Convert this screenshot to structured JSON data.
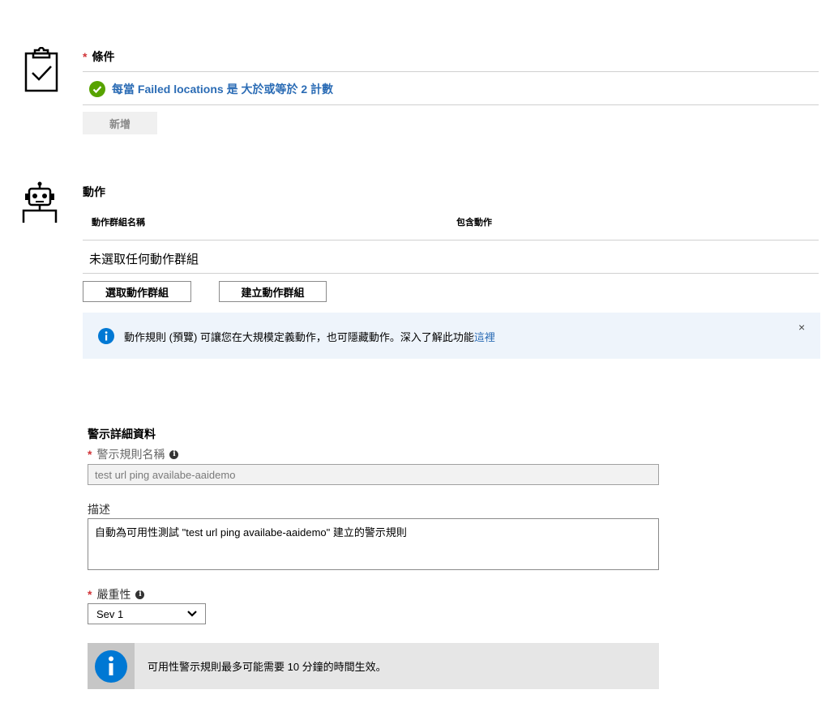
{
  "condition": {
    "required_mark": "*",
    "title": "條件",
    "link_text": "每當 Failed locations 是 大於或等於 2 計數",
    "add_button": "新增"
  },
  "actions": {
    "title": "動作",
    "col_group_name": "動作群組名稱",
    "col_contains": "包含動作",
    "empty_text": "未選取任何動作群組",
    "select_button": "選取動作群組",
    "create_button": "建立動作群組",
    "info_text": "動作規則 (預覽) 可讓您在大規模定義動作，也可隱藏動作。深入了解此功能",
    "info_link": "這裡",
    "close_glyph": "×"
  },
  "alert_details": {
    "title": "警示詳細資料",
    "rule_name_label": "警示規則名稱",
    "rule_name_value": "test url ping availabe-aaidemo",
    "description_label": "描述",
    "description_value": "自動為可用性測試 \"test url ping availabe-aaidemo\" 建立的警示規則",
    "severity_label": "嚴重性",
    "severity_value": "Sev 1",
    "note_text": "可用性警示規則最多可能需要 10 分鐘的時間生效。",
    "required_mark": "*",
    "info_glyph": "i"
  },
  "colors": {
    "link": "#2b6cb5",
    "success": "#57a300",
    "required": "#d13438",
    "info_blue": "#0078d4"
  }
}
